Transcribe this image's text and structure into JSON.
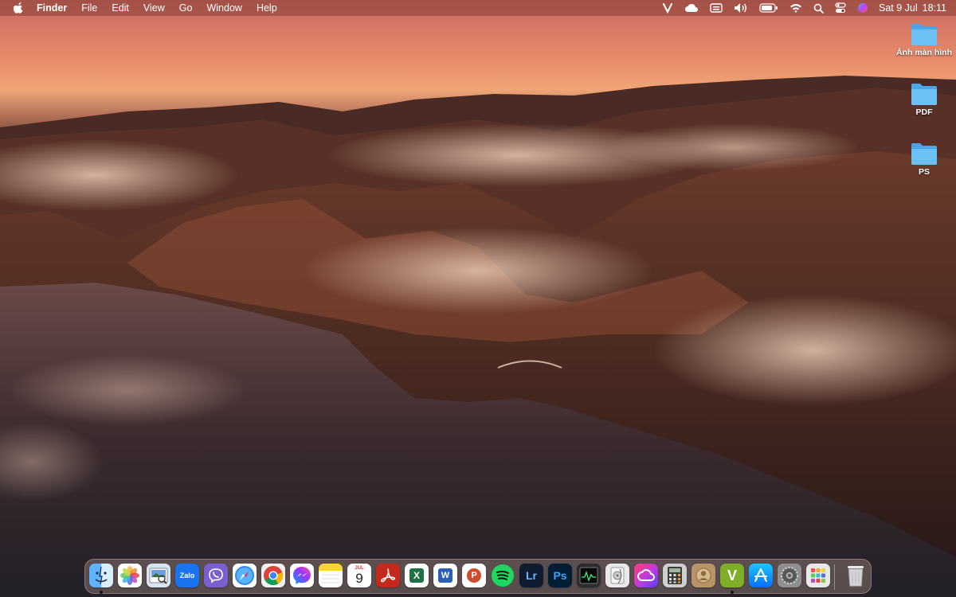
{
  "menubar": {
    "app_name": "Finder",
    "menus": [
      "File",
      "Edit",
      "View",
      "Go",
      "Window",
      "Help"
    ],
    "status_icons": [
      "viber-status-icon",
      "icloud-icon",
      "keyboard-icon",
      "volume-icon",
      "battery-icon",
      "wifi-icon",
      "spotlight-search-icon",
      "control-center-icon",
      "siri-icon"
    ],
    "date": "Sat 9 Jul",
    "time": "18:11"
  },
  "desktop": {
    "folders": [
      {
        "label": "Ảnh màn hình"
      },
      {
        "label": "PDF"
      },
      {
        "label": "PS"
      }
    ]
  },
  "dock": {
    "apps": [
      {
        "name": "Finder",
        "icon": "finder-icon",
        "running": true
      },
      {
        "name": "Photos",
        "icon": "photos-icon",
        "running": false
      },
      {
        "name": "Preview",
        "icon": "preview-icon",
        "running": false
      },
      {
        "name": "Zalo",
        "icon": "zalo-icon",
        "glyph": "Zalo",
        "running": false
      },
      {
        "name": "Viber",
        "icon": "viber-icon",
        "running": false
      },
      {
        "name": "Safari",
        "icon": "safari-icon",
        "running": false
      },
      {
        "name": "Google Chrome",
        "icon": "chrome-icon",
        "running": false
      },
      {
        "name": "Messenger",
        "icon": "messenger-icon",
        "running": false
      },
      {
        "name": "Notes",
        "icon": "notes-icon",
        "running": false
      },
      {
        "name": "Calendar",
        "icon": "calendar-icon",
        "month": "JUL",
        "day": "9",
        "running": false
      },
      {
        "name": "Acrobat Reader",
        "icon": "acrobat-icon",
        "running": false
      },
      {
        "name": "Excel",
        "icon": "excel-icon",
        "glyph": "X",
        "running": false
      },
      {
        "name": "Word",
        "icon": "word-icon",
        "glyph": "W",
        "running": false
      },
      {
        "name": "PowerPoint",
        "icon": "powerpoint-icon",
        "glyph": "P",
        "running": false
      },
      {
        "name": "Spotify",
        "icon": "spotify-icon",
        "running": false
      },
      {
        "name": "Lightroom",
        "icon": "lightroom-icon",
        "glyph": "Lr",
        "running": false
      },
      {
        "name": "Photoshop",
        "icon": "photoshop-icon",
        "glyph": "Ps",
        "running": false
      },
      {
        "name": "Activity Monitor",
        "icon": "activity-monitor-icon",
        "running": false
      },
      {
        "name": "Disk Utility",
        "icon": "disk-utility-icon",
        "running": false
      },
      {
        "name": "Creative Cloud",
        "icon": "creative-cloud-icon",
        "running": false
      },
      {
        "name": "Calculator",
        "icon": "calculator-icon",
        "running": false
      },
      {
        "name": "Contacts",
        "icon": "contacts-icon",
        "running": false
      },
      {
        "name": "Vectr",
        "icon": "v-app-icon",
        "glyph": "V",
        "running": true
      },
      {
        "name": "App Store",
        "icon": "app-store-icon",
        "running": false
      },
      {
        "name": "System Preferences",
        "icon": "system-preferences-icon",
        "running": false
      },
      {
        "name": "Launchpad",
        "icon": "launchpad-icon",
        "running": false
      },
      {
        "name": "Trash",
        "icon": "trash-icon",
        "running": false
      }
    ]
  },
  "colors": {
    "folder_blue": "#5fb8f0",
    "menubar_tint": "#7a3228"
  }
}
